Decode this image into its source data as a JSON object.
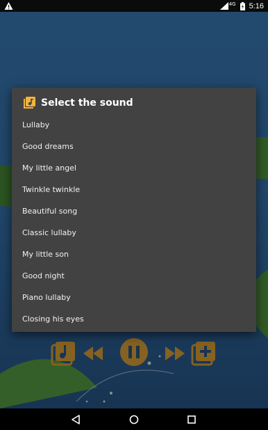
{
  "status_bar": {
    "time": "5:16",
    "network": "4G"
  },
  "dialog": {
    "title": "Select the sound",
    "items": [
      "Lullaby",
      "Good dreams",
      "My little angel",
      "Twinkle twinkle",
      "Beautiful song",
      "Classic lullaby",
      "My little son",
      "Good night",
      "Piano lullaby",
      "Closing his eyes"
    ]
  },
  "colors": {
    "accent": "#f2b33d",
    "dialog_bg": "#424242",
    "scene_sky": "#2f6fae",
    "scene_grass": "#4a8c3a"
  },
  "icons": {
    "dialog": "music-library-icon",
    "nav": [
      "back-icon",
      "home-icon",
      "recents-icon"
    ],
    "controls": [
      "music-library-icon",
      "rewind-icon",
      "pause-icon",
      "fast-forward-icon",
      "add-playlist-icon"
    ]
  }
}
